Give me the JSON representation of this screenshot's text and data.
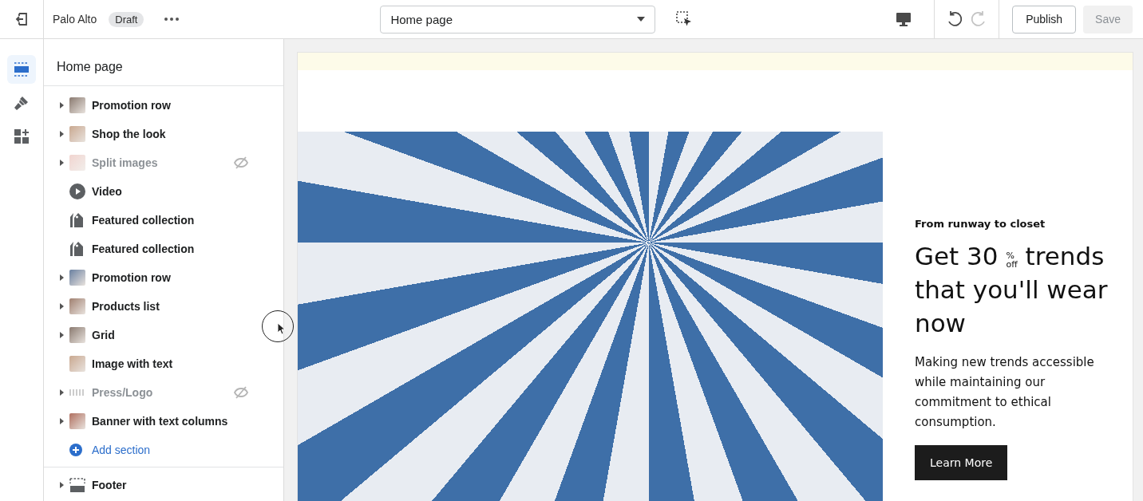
{
  "topbar": {
    "store_name": "Palo Alto",
    "status_badge": "Draft",
    "page_select": {
      "value": "Home page"
    },
    "undo_disabled": false,
    "redo_disabled": true,
    "publish": "Publish",
    "save": {
      "label": "Save",
      "disabled": true
    }
  },
  "rail": [
    {
      "kind": "sections",
      "selected": true
    },
    {
      "kind": "theme",
      "selected": false
    },
    {
      "kind": "apps",
      "selected": false
    }
  ],
  "sidebar": {
    "title": "Home page",
    "sections": [
      {
        "kind": "thumbnail",
        "label": "Promotion row",
        "expandable": true,
        "hidden": false
      },
      {
        "kind": "thumbnail",
        "label": "Shop the look",
        "expandable": true,
        "hidden": false
      },
      {
        "kind": "thumbnail",
        "label": "Split images",
        "expandable": true,
        "hidden": true
      },
      {
        "kind": "video",
        "label": "Video",
        "expandable": false,
        "hidden": false
      },
      {
        "kind": "collection",
        "label": "Featured collection",
        "expandable": false,
        "hidden": false
      },
      {
        "kind": "collection",
        "label": "Featured collection",
        "expandable": false,
        "hidden": false
      },
      {
        "kind": "thumbnail",
        "label": "Promotion row",
        "expandable": true,
        "hidden": false
      },
      {
        "kind": "thumbnail",
        "label": "Products list",
        "expandable": true,
        "hidden": false
      },
      {
        "kind": "thumbnail",
        "label": "Grid",
        "expandable": true,
        "hidden": false
      },
      {
        "kind": "thumbnail",
        "label": "Image with text",
        "expandable": false,
        "hidden": false
      },
      {
        "kind": "logo",
        "label": "Press/Logo",
        "expandable": true,
        "hidden": true
      },
      {
        "kind": "thumbnail",
        "label": "Banner with text columns",
        "expandable": true,
        "hidden": false
      }
    ],
    "add_section": "Add section",
    "footer": {
      "label": "Footer",
      "expandable": true
    }
  },
  "preview": {
    "eyebrow": "From runway to closet",
    "headline_start": "Get 30",
    "headline_mark_top": "%",
    "headline_mark_bottom": "off",
    "headline_rest": "trends that you'll wear now",
    "body": "Making new trends accessible while maintaining our commitment to ethical consumption.",
    "button": "Learn More"
  }
}
